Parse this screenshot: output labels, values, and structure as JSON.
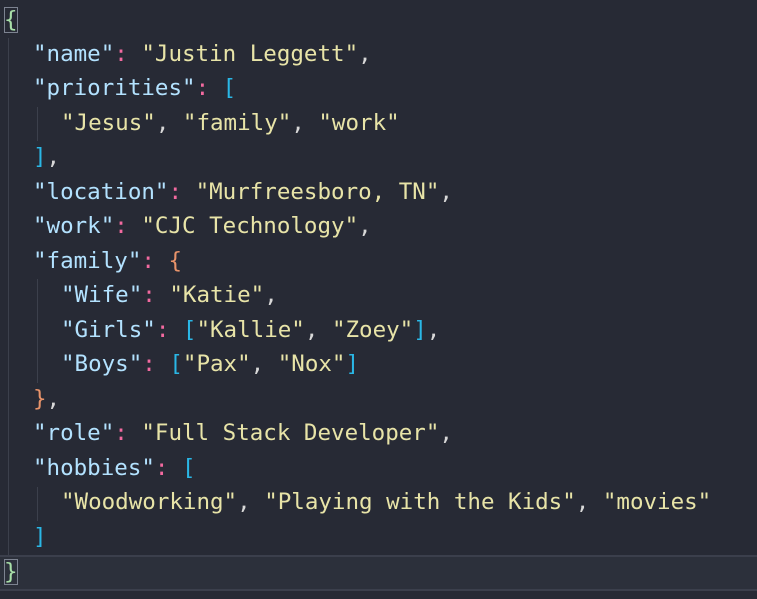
{
  "code": {
    "open_brace": "{",
    "close_brace": "}",
    "name_key": "\"name\"",
    "name_val": "\"Justin Leggett\"",
    "priorities_key": "\"priorities\"",
    "priorities": [
      "\"Jesus\"",
      "\"family\"",
      "\"work\""
    ],
    "location_key": "\"location\"",
    "location_val": "\"Murfreesboro, TN\"",
    "work_key": "\"work\"",
    "work_val": "\"CJC Technology\"",
    "family_key": "\"family\"",
    "wife_key": "\"Wife\"",
    "wife_val": "\"Katie\"",
    "girls_key": "\"Girls\"",
    "girls": [
      "\"Kallie\"",
      "\"Zoey\""
    ],
    "boys_key": "\"Boys\"",
    "boys": [
      "\"Pax\"",
      "\"Nox\""
    ],
    "role_key": "\"role\"",
    "role_val": "\"Full Stack Developer\"",
    "hobbies_key": "\"hobbies\"",
    "hobbies": [
      "\"Woodworking\"",
      "\"Playing with the Kids\"",
      "\"movies\""
    ]
  },
  "colors": {
    "background": "#272a35",
    "key": "#b3e2ff",
    "string": "#e8e4a8",
    "colon": "#f36aa0",
    "square_bracket": "#2ab7e6",
    "curly_brace": "#e8936a",
    "top_brace": "#a9e0a9"
  }
}
